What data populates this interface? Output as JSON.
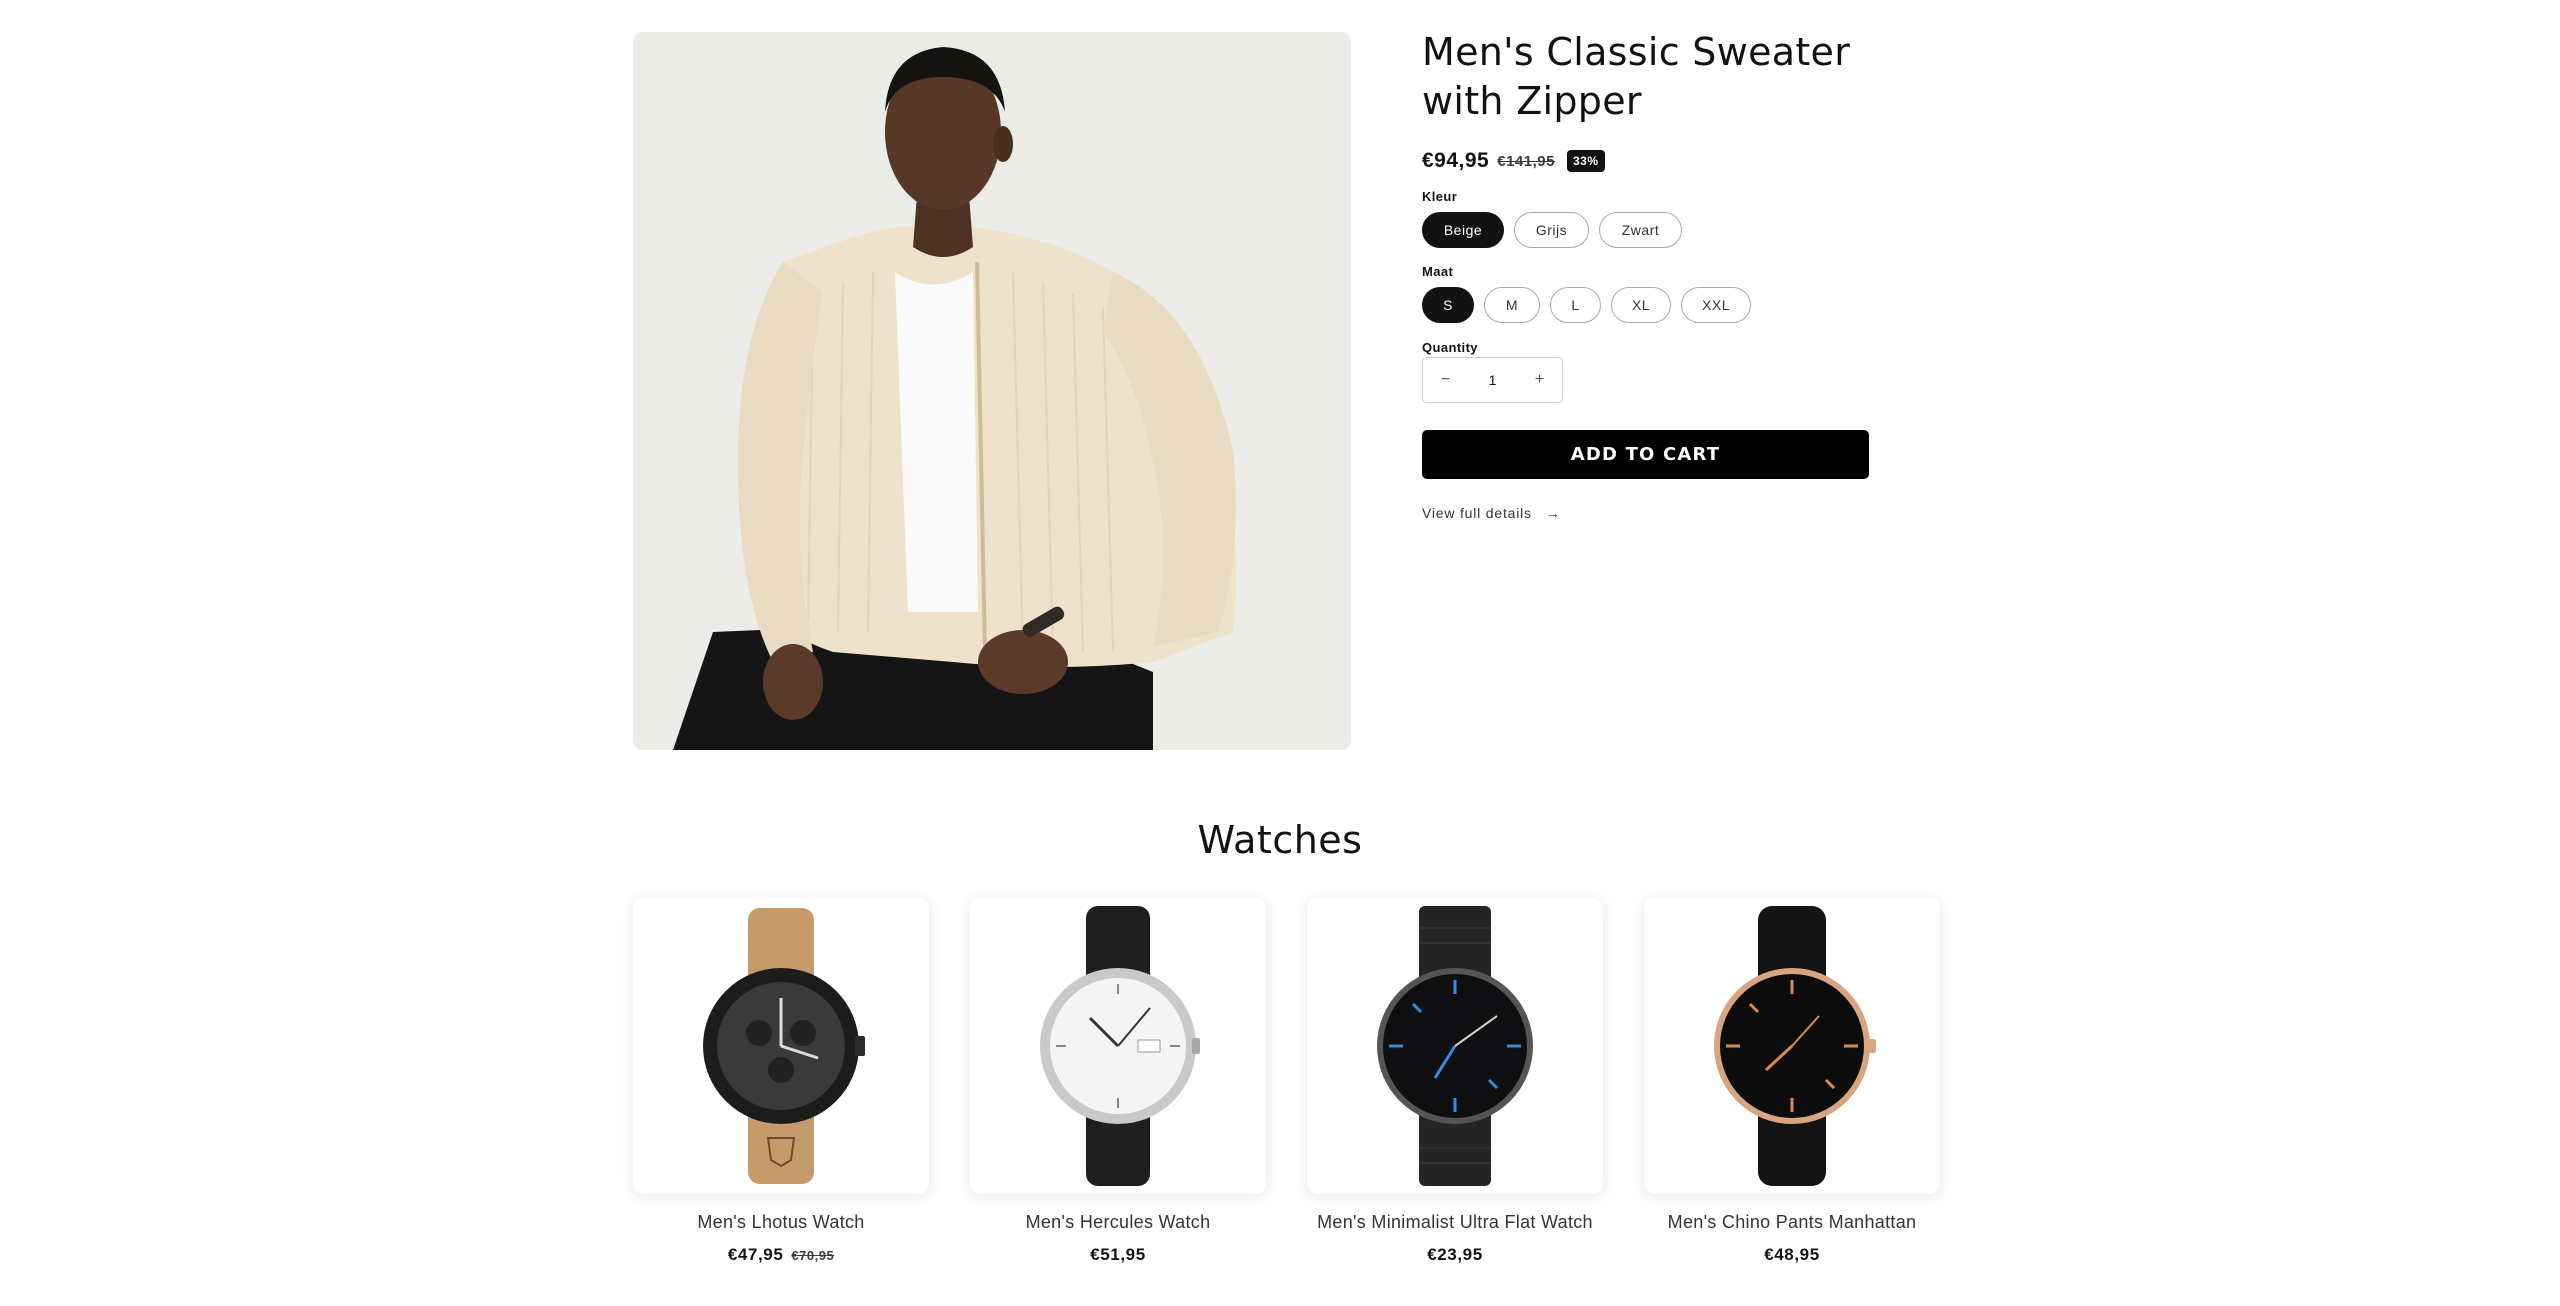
{
  "product": {
    "title": "Men's Classic Sweater with Zipper",
    "price_sale": "€94,95",
    "price_compare": "€141,95",
    "discount_badge": "33%",
    "color_label": "Kleur",
    "colors": [
      "Beige",
      "Grijs",
      "Zwart"
    ],
    "selected_color": "Beige",
    "size_label": "Maat",
    "sizes": [
      "S",
      "M",
      "L",
      "XL",
      "XXL"
    ],
    "selected_size": "S",
    "quantity_label": "Quantity",
    "quantity_value": "1",
    "quantity_minus": "−",
    "quantity_plus": "+",
    "add_to_cart": "ADD TO CART",
    "view_details": "View full details",
    "view_details_arrow": "→"
  },
  "recommendations": {
    "title": "Watches",
    "items": [
      {
        "title": "Men's Lhotus Watch",
        "price_sale": "€47,95",
        "price_compare": "€70,95",
        "strap": "brown-leather"
      },
      {
        "title": "Men's Hercules Watch",
        "price_sale": "€51,95",
        "price_compare": "",
        "strap": "black-leather"
      },
      {
        "title": "Men's Minimalist Ultra Flat Watch",
        "price_sale": "€23,95",
        "price_compare": "",
        "strap": "black-mesh"
      },
      {
        "title": "Men's Chino Pants Manhattan",
        "price_sale": "€48,95",
        "price_compare": "",
        "strap": "black-leather"
      }
    ]
  },
  "colors": {
    "primary": "#121212",
    "button": "#000000",
    "pill_border": "#a9a9a9"
  }
}
